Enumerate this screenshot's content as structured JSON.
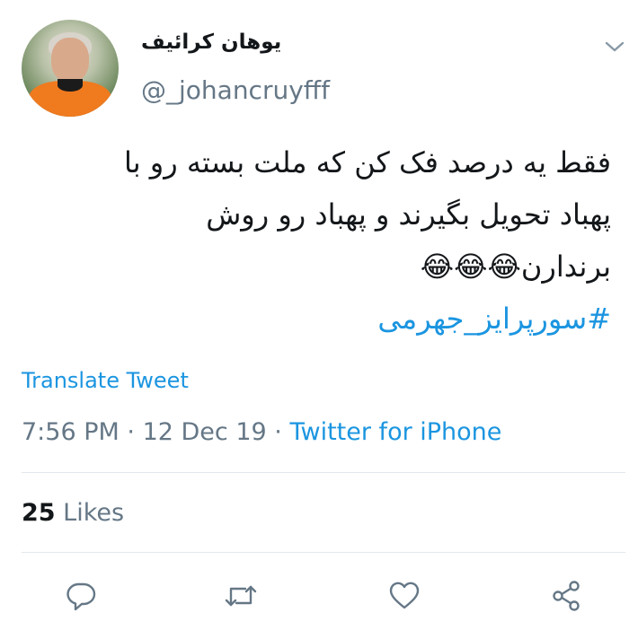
{
  "tweet": {
    "display_name": "یوهان کرائیف",
    "username": "@_johancruyfff",
    "text_lines": [
      "فقط یه درصد فک کن که ملت بسته رو با",
      "پهباد تحویل بگیرند و پهباد رو روش",
      "برندارن😂😂😂"
    ],
    "hashtag": "#سورپرایز_جهرمی",
    "translate_label": "Translate Tweet",
    "time": "7:56 PM",
    "separator": "·",
    "date": "12 Dec 19",
    "source": "Twitter for iPhone",
    "likes_count": "25",
    "likes_label": "Likes"
  },
  "actions": [
    "reply-icon",
    "retweet-icon",
    "like-icon",
    "share-icon"
  ],
  "colors": {
    "link": "#1b95e0",
    "muted": "#657786",
    "text": "#14171a",
    "divider": "#e1e8ed"
  }
}
